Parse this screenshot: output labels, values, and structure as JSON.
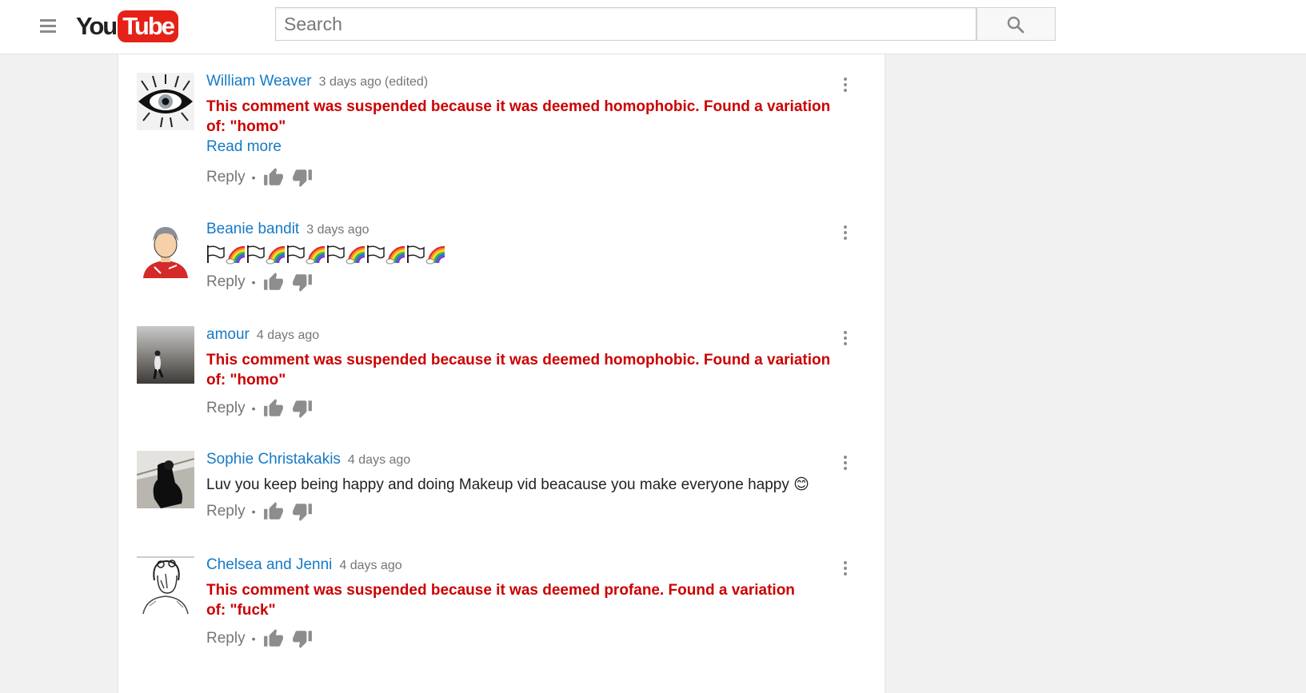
{
  "header": {
    "logo_you": "You",
    "logo_tube": "Tube",
    "search_placeholder": "Search"
  },
  "colors": {
    "brand_red": "#e62117",
    "link_blue": "#167ac6",
    "suspended_red": "#cc0000",
    "meta_gray": "#767676"
  },
  "icons": {
    "guide": "hamburger-menu-icon",
    "search": "magnifier-icon",
    "like": "thumbs-up-icon",
    "dislike": "thumbs-down-icon",
    "more": "vertical-ellipsis-icon"
  },
  "comments": [
    {
      "author": "William Weaver",
      "time": "3 days ago",
      "edited": "(edited)",
      "text": "This comment was suspended because it was deemed homophobic. Found a variation of: \"homo\"",
      "read_more": "Read more",
      "reply": "Reply",
      "separator": "•"
    },
    {
      "author": "Beanie bandit",
      "time": "3 days ago",
      "emoji_sequence": "🏳🌈🏳🌈🏳🌈🏳🌈🏳🌈🏳🌈",
      "reply": "Reply",
      "separator": "•"
    },
    {
      "author": "amour",
      "time": "4 days ago",
      "text": "This comment was suspended because it was deemed homophobic. Found a variation of: \"homo\"",
      "reply": "Reply",
      "separator": "•"
    },
    {
      "author": "Sophie Christakakis",
      "time": "4 days ago",
      "text": "Luv you keep being happy and doing Makeup vid beacause you make everyone happy",
      "emoji": "😊",
      "reply": "Reply",
      "separator": "•"
    },
    {
      "author": "Chelsea and Jenni",
      "time": "4 days ago",
      "text": "This comment was suspended because it was deemed profane. Found a variation of: \"fuck\"",
      "reply": "Reply",
      "separator": "•"
    }
  ]
}
